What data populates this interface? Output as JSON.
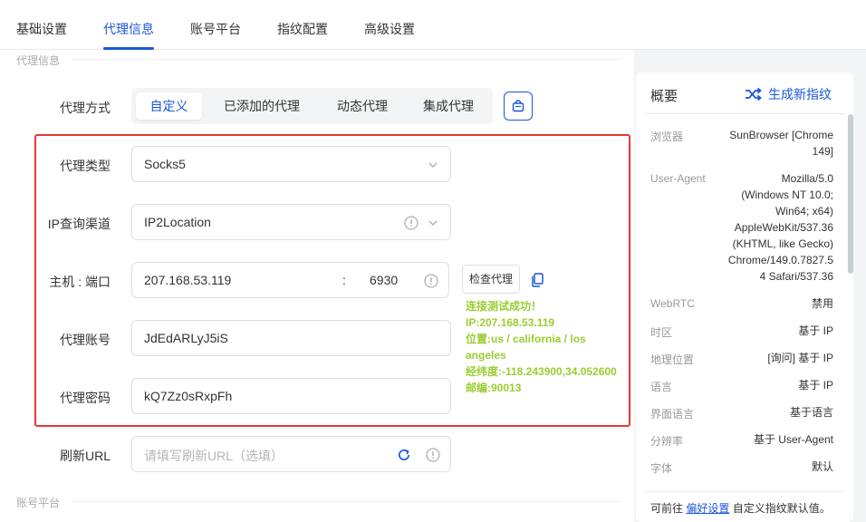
{
  "top_tabs": [
    "基础设置",
    "代理信息",
    "账号平台",
    "指纹配置",
    "高级设置"
  ],
  "section1": {
    "title": "代理信息"
  },
  "section2": {
    "title": "账号平台"
  },
  "proxy_method": {
    "label": "代理方式",
    "options": [
      "自定义",
      "已添加的代理",
      "动态代理",
      "集成代理"
    ],
    "selected": "自定义"
  },
  "proxy_type": {
    "label": "代理类型",
    "value": "Socks5"
  },
  "ip_channel": {
    "label": "IP查询渠道",
    "value": "IP2Location"
  },
  "host_port": {
    "label": "主机 : 端口",
    "host": "207.168.53.119",
    "sep": ":",
    "port": "6930"
  },
  "account": {
    "label": "代理账号",
    "value": "JdEdARLyJ5iS"
  },
  "password": {
    "label": "代理密码",
    "value": "kQ7Zz0sRxpFh"
  },
  "refresh_url": {
    "label": "刷新URL",
    "placeholder": "请填写刷新URL（选填）"
  },
  "check_button": "检查代理",
  "result": {
    "line1": "连接测试成功！",
    "line2": "IP:207.168.53.119",
    "line3": "位置:us / california / los",
    "line4": "angeles",
    "line5": "经纬度:-118.243900,34.052600",
    "line6": "邮编:90013"
  },
  "side": {
    "title": "概要",
    "generate": "生成新指纹",
    "items": [
      {
        "k": "浏览器",
        "v": [
          "SunBrowser [Chrome",
          "149]"
        ]
      },
      {
        "k": "User-Agent",
        "v": [
          "Mozilla/5.0",
          "(Windows NT 10.0;",
          "Win64; x64)",
          "AppleWebKit/537.36",
          "(KHTML, like Gecko)",
          "Chrome/149.0.7827.5",
          "4 Safari/537.36"
        ]
      },
      {
        "k": "WebRTC",
        "v": [
          "禁用"
        ]
      },
      {
        "k": "时区",
        "v": [
          "基于 IP"
        ]
      },
      {
        "k": "地理位置",
        "v": [
          "[询问] 基于 IP"
        ]
      },
      {
        "k": "语言",
        "v": [
          "基于 IP"
        ]
      },
      {
        "k": "界面语言",
        "v": [
          "基于语言"
        ]
      },
      {
        "k": "分辨率",
        "v": [
          "基于 User-Agent"
        ]
      },
      {
        "k": "字体",
        "v": [
          "默认"
        ]
      }
    ],
    "footer_prefix": "可前往",
    "footer_link": "偏好设置",
    "footer_suffix": "自定义指纹默认值。"
  },
  "colors": {
    "accent": "#1a56db",
    "success": "#9acd32",
    "highlight_border": "#e53935"
  }
}
